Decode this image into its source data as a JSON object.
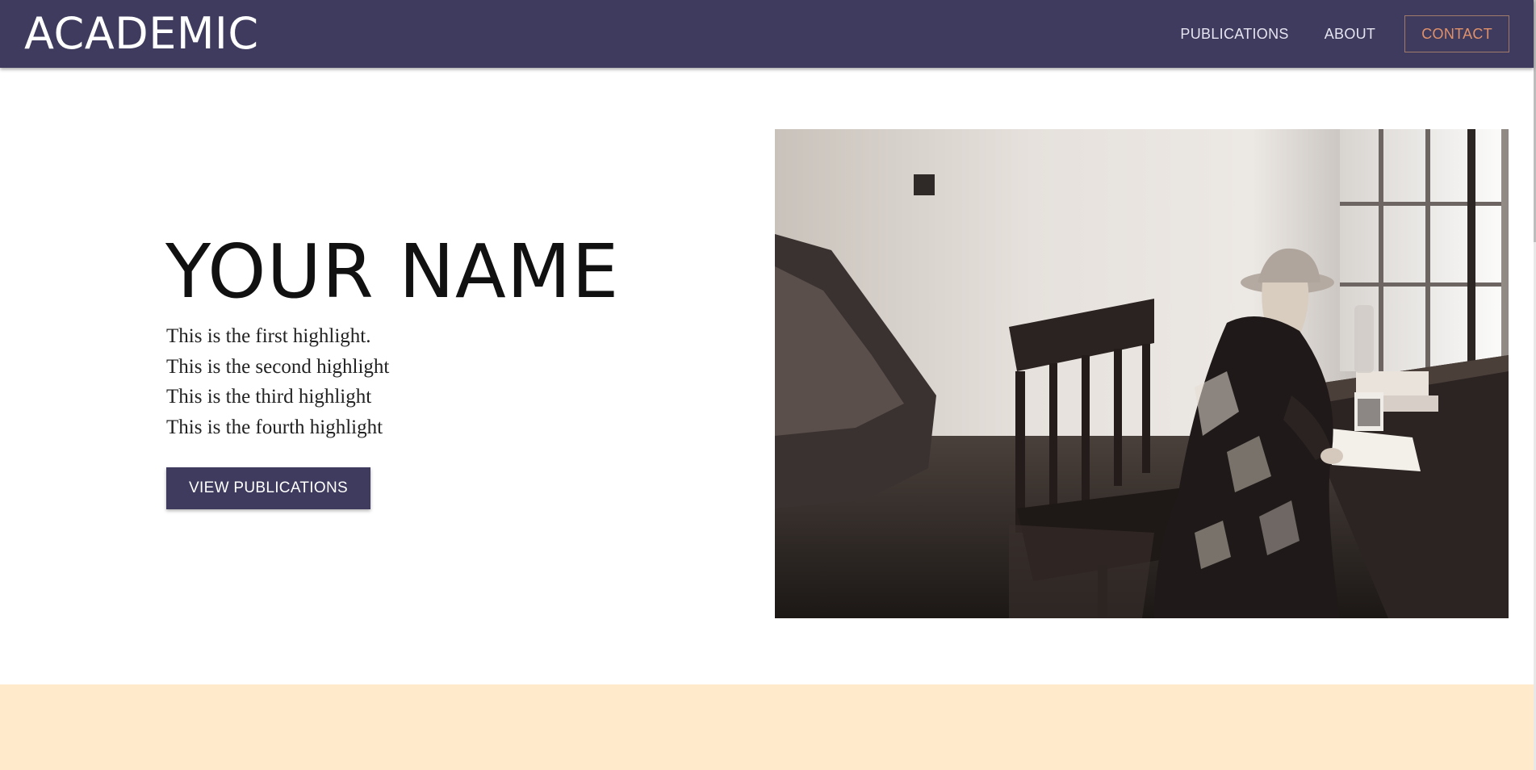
{
  "nav": {
    "brand": "ACADEMIC",
    "links": [
      "PUBLICATIONS",
      "ABOUT"
    ],
    "contact": "CONTACT"
  },
  "hero": {
    "name": "YOUR NAME",
    "highlights": [
      "This is the first highlight.",
      "This is the second highlight",
      "This is the third highlight",
      "This is the fourth highlight"
    ],
    "cta": "VIEW PUBLICATIONS"
  },
  "colors": {
    "nav_bg": "#3e3b5e",
    "contact_accent": "#e0916a",
    "cta_bg": "#3e3b5e",
    "band_bg": "#ffebcc"
  },
  "icons": {
    "photo": "woman-writing-at-desk-photo"
  }
}
